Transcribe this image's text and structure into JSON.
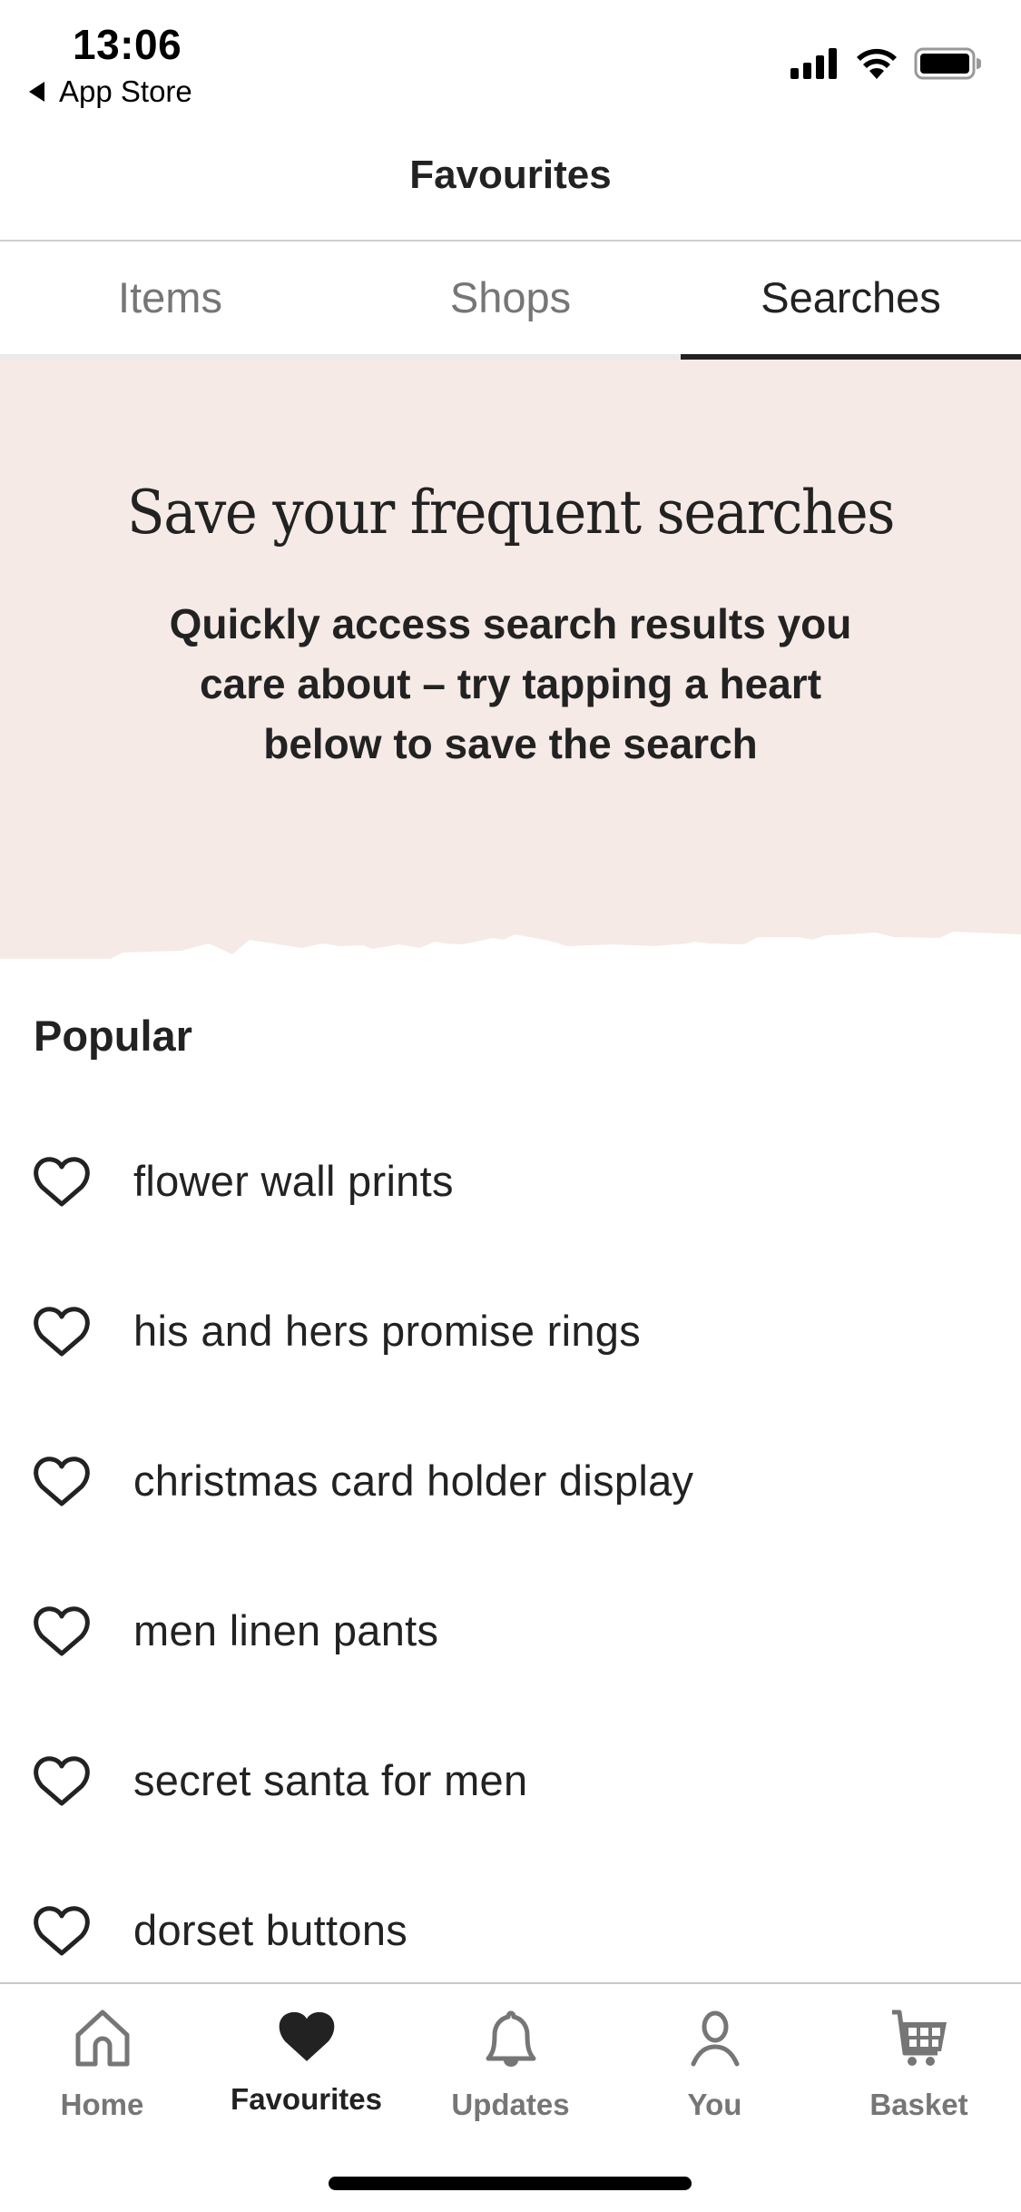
{
  "status_bar": {
    "time": "13:06",
    "back_label": "App Store",
    "icons": [
      "cellular-signal-icon",
      "wifi-icon",
      "battery-icon"
    ]
  },
  "header": {
    "title": "Favourites"
  },
  "tabs": [
    {
      "label": "Items",
      "active": false
    },
    {
      "label": "Shops",
      "active": false
    },
    {
      "label": "Searches",
      "active": true
    }
  ],
  "banner": {
    "title": "Save your frequent searches",
    "body": "Quickly access search results you care about – try tapping a heart below to save the search",
    "background_color": "#f5eae6"
  },
  "popular": {
    "title": "Popular",
    "items": [
      {
        "label": "flower wall prints",
        "icon": "heart-outline-icon",
        "saved": false
      },
      {
        "label": "his and hers promise rings",
        "icon": "heart-outline-icon",
        "saved": false
      },
      {
        "label": "christmas card holder display",
        "icon": "heart-outline-icon",
        "saved": false
      },
      {
        "label": "men linen pants",
        "icon": "heart-outline-icon",
        "saved": false
      },
      {
        "label": "secret santa for men",
        "icon": "heart-outline-icon",
        "saved": false
      },
      {
        "label": "dorset buttons",
        "icon": "heart-outline-icon",
        "saved": false
      }
    ]
  },
  "tab_bar": {
    "items": [
      {
        "label": "Home",
        "icon": "home-icon",
        "active": false
      },
      {
        "label": "Favourites",
        "icon": "heart-filled-icon",
        "active": true
      },
      {
        "label": "Updates",
        "icon": "bell-icon",
        "active": false
      },
      {
        "label": "You",
        "icon": "person-icon",
        "active": false
      },
      {
        "label": "Basket",
        "icon": "cart-icon",
        "active": false
      }
    ]
  },
  "colors": {
    "text_primary": "#222222",
    "text_inactive": "#767676",
    "banner_bg": "#f5eae6",
    "divider": "#cfcfcf"
  }
}
